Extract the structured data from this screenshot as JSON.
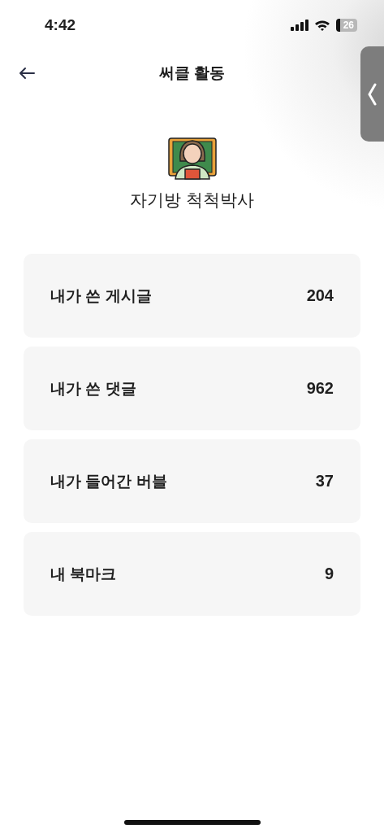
{
  "status_bar": {
    "time": "4:42",
    "battery": "26"
  },
  "header": {
    "title": "써클 활동"
  },
  "profile": {
    "name": "자기방 척척박사"
  },
  "stats": [
    {
      "label": "내가 쓴 게시글",
      "count": "204"
    },
    {
      "label": "내가 쓴 댓글",
      "count": "962"
    },
    {
      "label": "내가 들어간 버블",
      "count": "37"
    },
    {
      "label": "내 북마크",
      "count": "9"
    }
  ]
}
